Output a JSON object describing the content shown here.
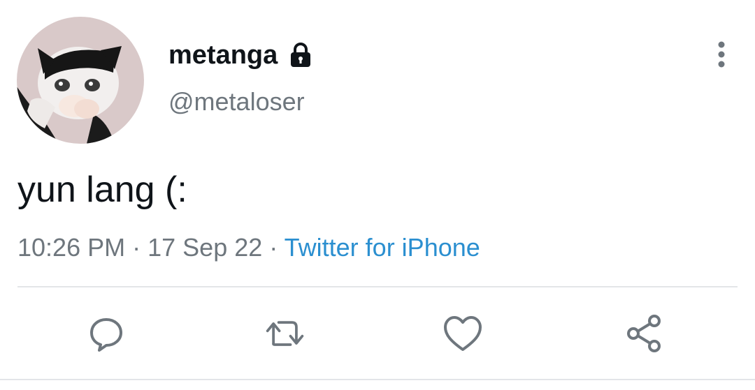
{
  "user": {
    "display_name": "metanga",
    "handle": "@metaloser",
    "protected": true,
    "avatar_icon": "crying-cat-avatar"
  },
  "tweet": {
    "text": "yun lang (:",
    "time": "10:26 PM",
    "separator": "·",
    "date": "17 Sep 22",
    "source": "Twitter for iPhone"
  },
  "actions": [
    {
      "icon": "reply-icon"
    },
    {
      "icon": "retweet-icon"
    },
    {
      "icon": "like-icon"
    },
    {
      "icon": "share-icon"
    }
  ],
  "colors": {
    "text": "#0f1419",
    "secondary": "#6e767d",
    "link": "#2b8fd0",
    "divider": "#e3e5e8"
  }
}
